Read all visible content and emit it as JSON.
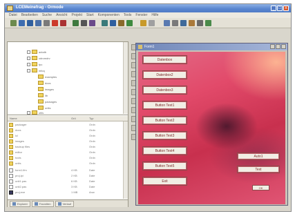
{
  "window": {
    "title": "LCEMeinefrag - Ormode",
    "min": "_",
    "max": "□",
    "close": "x"
  },
  "menu": [
    "Datei",
    "Bearbeiten",
    "Suche",
    "Ansicht",
    "Projekt",
    "Start",
    "Komponenten",
    "Tools",
    "Fenster",
    "Hilfe"
  ],
  "toolbar": {
    "icons": [
      "new-icon",
      "open-icon",
      "save-icon",
      "save-all-icon",
      "cut-icon",
      "copy-icon",
      "paste-icon",
      "run-icon",
      "stop-icon",
      "form-icon",
      "unit-icon",
      "toggle-icon",
      "build-icon",
      "debug-icon",
      "step-icon",
      "help-icon"
    ]
  },
  "tree": {
    "items": [
      {
        "label": "adodb",
        "level": 0
      },
      {
        "label": "cdromdrv",
        "level": 0
      },
      {
        "label": "fpc",
        "level": 0
      },
      {
        "label": "infoq",
        "level": 0
      },
      {
        "label": "examples",
        "level": 1
      },
      {
        "label": "docs",
        "level": 1
      },
      {
        "label": "images",
        "level": 1
      },
      {
        "label": "lib",
        "level": 1
      },
      {
        "label": "packages",
        "level": 1
      },
      {
        "label": "units",
        "level": 1
      },
      {
        "label": "utils",
        "level": 0
      }
    ]
  },
  "filelist": {
    "headers": [
      "Name",
      "Grö",
      "Typ"
    ],
    "rows": [
      {
        "name": "packager",
        "size": "",
        "type": "Ordn",
        "icon": "folder"
      },
      {
        "name": "docs",
        "size": "",
        "type": "Ordn",
        "icon": "folder"
      },
      {
        "name": "lcl",
        "size": "",
        "type": "Ordn",
        "icon": "folder"
      },
      {
        "name": "images",
        "size": "",
        "type": "Ordn",
        "icon": "folder"
      },
      {
        "name": "backup files",
        "size": "",
        "type": "Ordn",
        "icon": "folder"
      },
      {
        "name": "editor",
        "size": "",
        "type": "Ordn",
        "icon": "folder"
      },
      {
        "name": "tools",
        "size": "",
        "type": "Ordn",
        "icon": "folder"
      },
      {
        "name": "units",
        "size": "",
        "type": "Ordn",
        "icon": "folder"
      },
      {
        "name": "form1.lfm",
        "size": "4 KB",
        "type": "Date",
        "icon": "file"
      },
      {
        "name": "proj.lpi",
        "size": "2 KB",
        "type": "Date",
        "icon": "file"
      },
      {
        "name": "unit1.pas",
        "size": "6 KB",
        "type": "Date",
        "icon": "file"
      },
      {
        "name": "unit2.pas",
        "size": "3 KB",
        "type": "Date",
        "icon": "file"
      },
      {
        "name": "proj.exe",
        "size": "1 MB",
        "type": "Anw",
        "icon": "dark"
      }
    ]
  },
  "bottom_tabs": [
    "Explorer",
    "Favoriten",
    "Verlauf"
  ],
  "form": {
    "title": "Form1",
    "buttons": [
      "Datenbox",
      "Datenbox2",
      "Datenbox3",
      "Button Text1",
      "Button Text2",
      "Button Text3",
      "Button Text4",
      "Button Text5",
      "Button Text6",
      "Exit"
    ],
    "right_buttons": [
      "Auto1",
      "Text"
    ],
    "small_buttons": [
      "OK",
      "X"
    ]
  }
}
